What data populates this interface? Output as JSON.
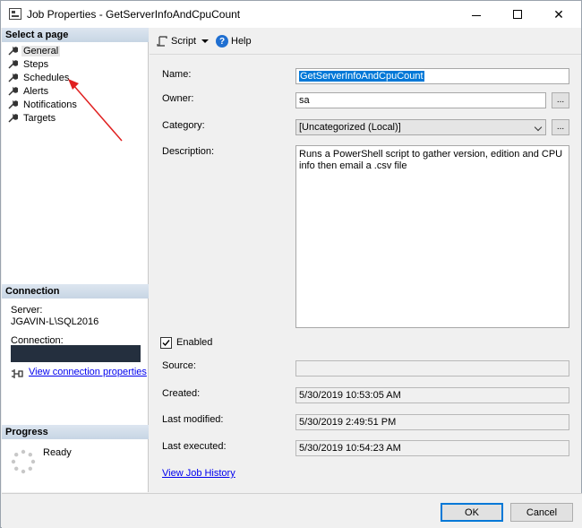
{
  "window": {
    "title": "Job Properties - GetServerInfoAndCpuCount"
  },
  "sidebar": {
    "header": "Select a page",
    "items": [
      {
        "label": "General",
        "selected": true
      },
      {
        "label": "Steps"
      },
      {
        "label": "Schedules"
      },
      {
        "label": "Alerts"
      },
      {
        "label": "Notifications"
      },
      {
        "label": "Targets"
      }
    ]
  },
  "connection": {
    "header": "Connection",
    "server_label": "Server:",
    "server_value": "JGAVIN-L\\SQL2016",
    "connection_label": "Connection:",
    "view_props_link": "View connection properties"
  },
  "progress": {
    "header": "Progress",
    "status": "Ready"
  },
  "toolbar": {
    "script_label": "Script",
    "help_label": "Help"
  },
  "form": {
    "name_label": "Name:",
    "name_value": "GetServerInfoAndCpuCount",
    "owner_label": "Owner:",
    "owner_value": "sa",
    "category_label": "Category:",
    "category_value": "[Uncategorized (Local)]",
    "description_label": "Description:",
    "description_value": "Runs a PowerShell script to gather version, edition and CPU info then email a .csv file",
    "enabled_label": "Enabled",
    "enabled_checked": true,
    "source_label": "Source:",
    "source_value": "",
    "created_label": "Created:",
    "created_value": "5/30/2019 10:53:05 AM",
    "last_modified_label": "Last modified:",
    "last_modified_value": "5/30/2019 2:49:51 PM",
    "last_executed_label": "Last executed:",
    "last_executed_value": "5/30/2019 10:54:23 AM",
    "view_history_link": "View Job History",
    "browse_button_label": "..."
  },
  "buttons": {
    "ok": "OK",
    "cancel": "Cancel"
  },
  "colors": {
    "annotation_arrow": "#e02020",
    "selection": "#0078d7",
    "link": "#0000ee"
  }
}
